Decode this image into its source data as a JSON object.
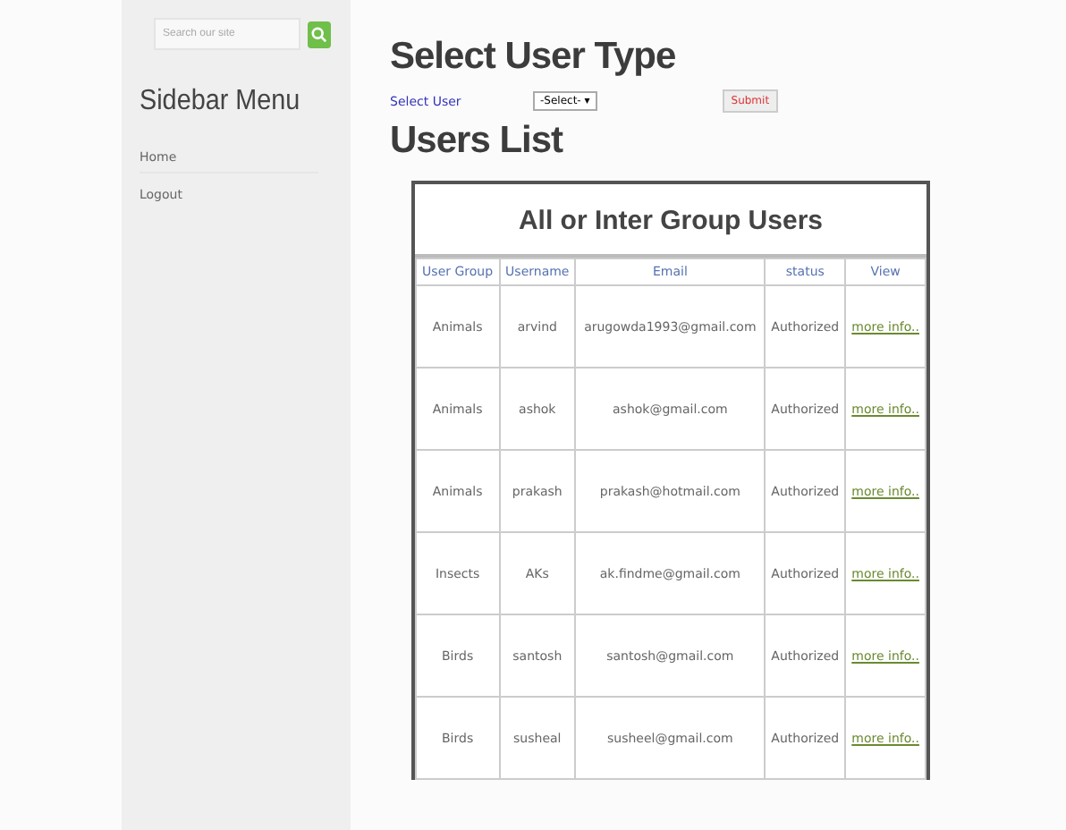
{
  "sidebar": {
    "search": {
      "placeholder": "Search our site"
    },
    "title": "Sidebar Menu",
    "items": [
      {
        "label": "Home"
      },
      {
        "label": "Logout"
      }
    ]
  },
  "select_user_type": {
    "heading": "Select User Type",
    "label": "Select User",
    "dropdown": "-Select- ▾",
    "submit": "Submit"
  },
  "users_list": {
    "heading": "Users List",
    "table_title": "All or Inter Group Users",
    "columns": [
      "User Group",
      "Username",
      "Email",
      "status",
      "View"
    ],
    "rows": [
      {
        "group": "Animals",
        "username": "arvind",
        "email": "arugowda1993@gmail.com",
        "status": "Authorized",
        "view": "more info.."
      },
      {
        "group": "Animals",
        "username": "ashok",
        "email": "ashok@gmail.com",
        "status": "Authorized",
        "view": "more info.."
      },
      {
        "group": "Animals",
        "username": "prakash",
        "email": "prakash@hotmail.com",
        "status": "Authorized",
        "view": "more info.."
      },
      {
        "group": "Insects",
        "username": "AKs",
        "email": "ak.findme@gmail.com",
        "status": "Authorized",
        "view": "more info.."
      },
      {
        "group": "Birds",
        "username": "santosh",
        "email": "santosh@gmail.com",
        "status": "Authorized",
        "view": "more info.."
      },
      {
        "group": "Birds",
        "username": "susheal",
        "email": "susheel@gmail.com",
        "status": "Authorized",
        "view": "more info.."
      }
    ]
  }
}
